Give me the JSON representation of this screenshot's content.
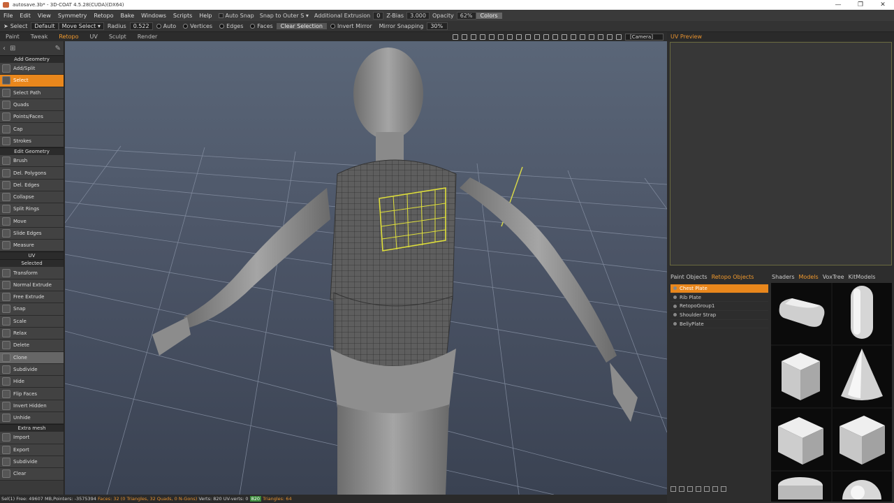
{
  "title": "autosave.3b* - 3D-COAT 4.5.28(CUDA)(DX64)",
  "window_buttons": [
    "—",
    "❐",
    "✕"
  ],
  "menu": [
    "File",
    "Edit",
    "View",
    "Symmetry",
    "Retopo",
    "Bake",
    "Windows",
    "Scripts",
    "Help"
  ],
  "menu_options": {
    "auto_snap": "Auto Snap",
    "snap_mode": "Snap to Outer S ▾",
    "additional_extrusion": "Additional Extrusion",
    "additional_extrusion_val": "0",
    "zbias": "Z-Bias",
    "zbias_val": "3.000",
    "opacity": "Opacity",
    "opacity_val": "62%",
    "colors": "Colors"
  },
  "tool_options": {
    "select": "Select",
    "default": "Default",
    "move_select": "Move Select ▾",
    "radius": "Radius",
    "radius_val": "0.522",
    "auto": "Auto",
    "vertices": "Vertices",
    "edges": "Edges",
    "faces": "Faces",
    "clear_selection": "Clear Selection",
    "invert_mirror": "Invert Mirror",
    "mirror_snapping": "Mirror Snapping",
    "mirror_snapping_val": "30%"
  },
  "rooms": [
    "Paint",
    "Tweak",
    "Retopo",
    "UV",
    "Sculpt",
    "Render"
  ],
  "active_room": "Retopo",
  "camera_field": "[Camera]",
  "left_panel": {
    "sections": {
      "add_geometry": "Add Geometry",
      "edit_geometry": "Edit Geometry",
      "uv": "UV",
      "selected": "Selected",
      "extra_mesh": "Extra mesh"
    },
    "add_tools": [
      "Add/Split",
      "Select",
      "Select Path",
      "Quads",
      "Points/Faces",
      "Cap",
      "Strokes"
    ],
    "edit_tools": [
      "Brush",
      "Del. Polygons",
      "Del. Edges",
      "Collapse",
      "Split Rings",
      "Move",
      "Slide Edges",
      "Measure"
    ],
    "selected_tools": [
      "Transform",
      "Normal Extrude",
      "Free Extrude",
      "Snap",
      "Scale",
      "Relax",
      "Delete",
      "Clone",
      "Subdivide",
      "Hide",
      "Flip Faces",
      "Invert Hidden",
      "Unhide"
    ],
    "extra_tools": [
      "Import",
      "Export",
      "Subdivide",
      "Clear"
    ]
  },
  "uv_preview_title": "UV Preview",
  "object_tabs": [
    "Paint Objects",
    "Retopo Objects"
  ],
  "active_object_tab": "Retopo Objects",
  "retopo_objects": [
    "Chest Plate",
    "Rib Plate",
    "RetopoGroup1",
    "Shoulder Strap",
    "BellyPlate"
  ],
  "active_object": "Chest Plate",
  "shader_tabs": [
    "Shaders",
    "Models",
    "VoxTree",
    "KitModels"
  ],
  "active_shader_tab": "Models",
  "status": {
    "prefix": "Sel(1)",
    "free": "Free: 49607 MB,Pointers: -3575394",
    "faces": "Faces: 32 (0 Triangles, 32 Quads, 0 N-Gons)",
    "verts": "Verts: 820 UV-verts: 0",
    "green": "820",
    "triangles": "Triangles: 64"
  }
}
